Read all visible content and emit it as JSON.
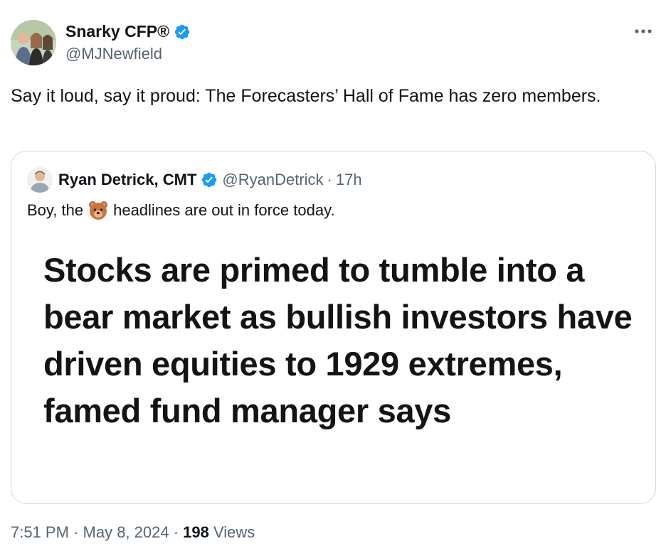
{
  "author": {
    "name": "Snarky CFP®",
    "handle": "@MJNewfield",
    "verified": true
  },
  "tweet": {
    "text": "Say it loud, say it proud: The Forecasters’ Hall of Fame has zero members."
  },
  "quoted": {
    "name": "Ryan Detrick, CMT",
    "handle": "@RyanDetrick",
    "separator": "·",
    "time": "17h",
    "text_before": "Boy, the",
    "emoji": "bear-face-emoji",
    "text_after": "headlines are out in force today.",
    "headline": "Stocks are primed to tumble into a bear market as bullish investors have driven equities to 1929 extremes, famed fund manager says"
  },
  "footer": {
    "time": "7:51 PM",
    "dot1": "·",
    "date": "May 8, 2024",
    "dot2": "·",
    "views_count": "198",
    "views_label": "Views"
  },
  "icons": {
    "verified": "verified-badge-icon",
    "more": "more-horizontal-icon"
  },
  "colors": {
    "verified_blue": "#1d9bf0",
    "secondary_text": "#536471",
    "border": "#cfd9de"
  }
}
